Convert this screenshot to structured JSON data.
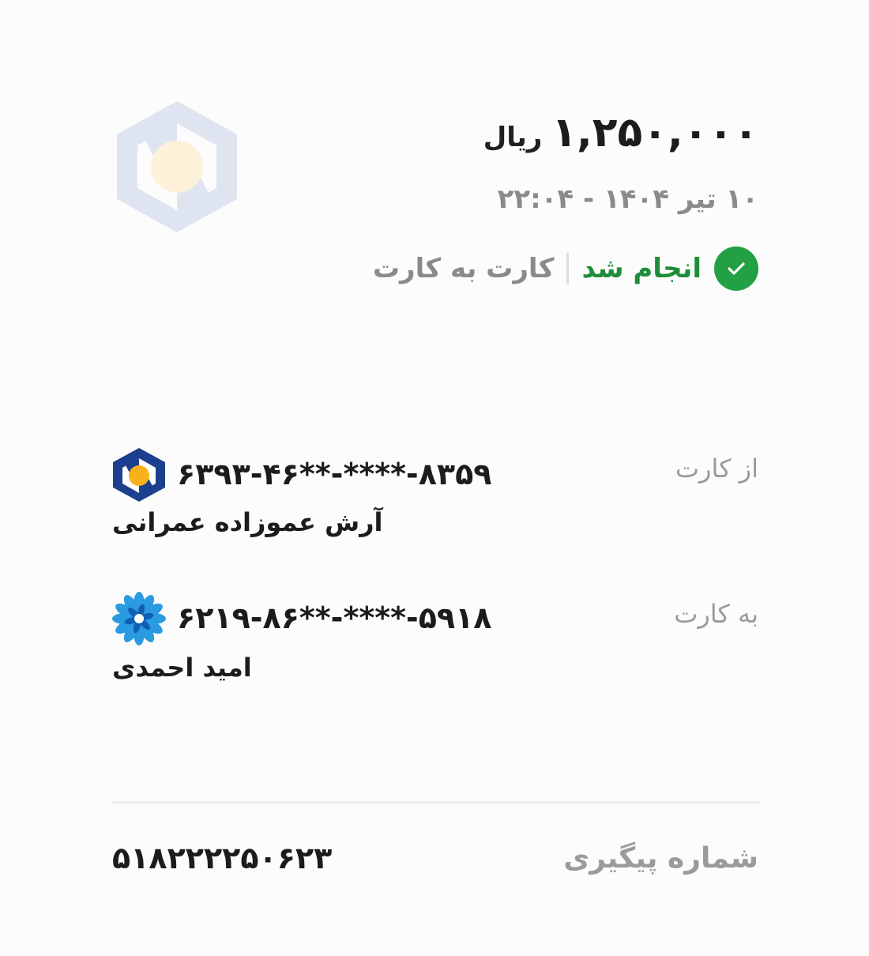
{
  "summary": {
    "amount": "۱,۲۵۰,۰۰۰",
    "currency": "ریال",
    "datetime": "۱۰ تیر ۱۴۰۴ - ۲۲:۰۴",
    "status": "انجام شد",
    "transfer_type": "کارت به کارت",
    "status_color": "#23a044"
  },
  "source": {
    "label": "از کارت",
    "card_number": "۶۳۹۳-۴۶**-****-۸۳۵۹",
    "owner": "آرش عموزاده عمرانی",
    "bank_icon": "bank-sepah-icon"
  },
  "destination": {
    "label": "به کارت",
    "card_number": "۶۲۱۹-۸۶**-****-۵۹۱۸",
    "owner": "امید احمدی",
    "bank_icon": "bank-saman-flower-icon"
  },
  "tracking": {
    "label": "شماره پیگیری",
    "value": "۵۱۸۲۲۲۲۵۰۶۲۳"
  }
}
